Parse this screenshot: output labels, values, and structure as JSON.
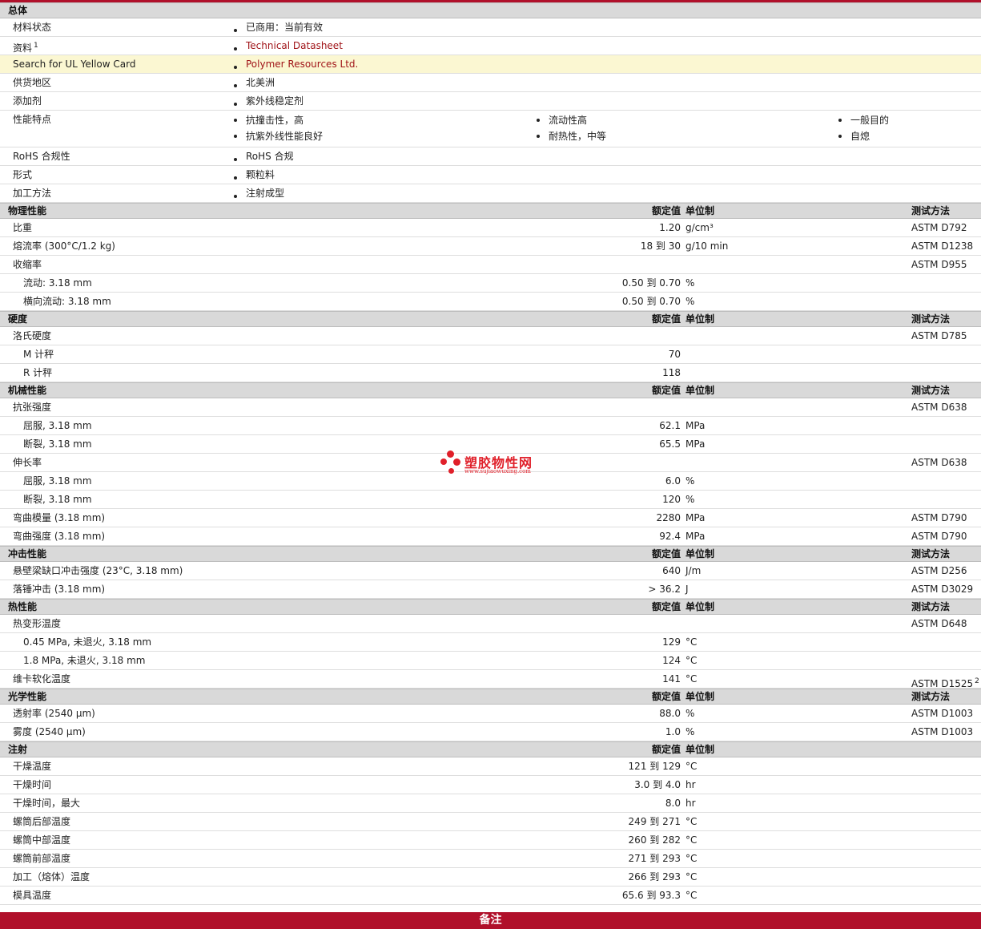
{
  "general": {
    "title": "总体",
    "rows": [
      {
        "label": "材料状态",
        "value": "已商用：当前有效"
      },
      {
        "label": "资料",
        "sup": "1",
        "value": "Technical Datasheet"
      },
      {
        "label": "Search for UL Yellow Card",
        "value": "Polymer Resources Ltd."
      },
      {
        "label": "供货地区",
        "value": "北美洲"
      },
      {
        "label": "添加剂",
        "value": "紫外线稳定剂"
      },
      {
        "label": "性能特点",
        "cols": [
          [
            "抗撞击性，高",
            "抗紫外线性能良好"
          ],
          [
            "流动性高",
            "耐热性，中等"
          ],
          [
            "一般目的",
            "自熄"
          ]
        ]
      },
      {
        "label": "RoHS 合规性",
        "value": "RoHS 合规"
      },
      {
        "label": "形式",
        "value": "颗粒料"
      },
      {
        "label": "加工方法",
        "value": "注射成型"
      }
    ]
  },
  "headers": {
    "value": "额定值",
    "unit": "单位制",
    "method": "测试方法"
  },
  "sections": [
    {
      "title": "物理性能",
      "rows": [
        {
          "label": "比重",
          "value": "1.20",
          "unit": "g/cm³",
          "method": "ASTM D792"
        },
        {
          "label": "熔流率  (300°C/1.2 kg)",
          "value": "18 到  30",
          "unit": "g/10 min",
          "method": "ASTM D1238"
        },
        {
          "label": "收缩率",
          "value": "",
          "unit": "",
          "method": "ASTM D955"
        },
        {
          "label": "流动: 3.18 mm",
          "sub": true,
          "value": "0.50 到  0.70",
          "unit": "%",
          "method": ""
        },
        {
          "label": "横向流动: 3.18 mm",
          "sub": true,
          "value": "0.50 到  0.70",
          "unit": "%",
          "method": ""
        }
      ]
    },
    {
      "title": "硬度",
      "rows": [
        {
          "label": "洛氏硬度",
          "value": "",
          "unit": "",
          "method": "ASTM D785"
        },
        {
          "label": "M 计秤",
          "sub": true,
          "value": "70",
          "unit": "",
          "method": ""
        },
        {
          "label": "R 计秤",
          "sub": true,
          "value": "118",
          "unit": "",
          "method": ""
        }
      ]
    },
    {
      "title": "机械性能",
      "rows": [
        {
          "label": "抗张强度",
          "value": "",
          "unit": "",
          "method": "ASTM D638"
        },
        {
          "label": "屈服, 3.18 mm",
          "sub": true,
          "value": "62.1",
          "unit": "MPa",
          "method": ""
        },
        {
          "label": "断裂, 3.18 mm",
          "sub": true,
          "value": "65.5",
          "unit": "MPa",
          "method": ""
        },
        {
          "label": "伸长率",
          "value": "",
          "unit": "",
          "method": "ASTM D638"
        },
        {
          "label": "屈服, 3.18 mm",
          "sub": true,
          "value": "6.0",
          "unit": "%",
          "method": ""
        },
        {
          "label": "断裂, 3.18 mm",
          "sub": true,
          "value": "120",
          "unit": "%",
          "method": ""
        },
        {
          "label": "弯曲模量  (3.18 mm)",
          "value": "2280",
          "unit": "MPa",
          "method": "ASTM D790"
        },
        {
          "label": "弯曲强度  (3.18 mm)",
          "value": "92.4",
          "unit": "MPa",
          "method": "ASTM D790"
        }
      ]
    },
    {
      "title": "冲击性能",
      "rows": [
        {
          "label": "悬壁梁缺口冲击强度  (23°C, 3.18 mm)",
          "value": "640",
          "unit": "J/m",
          "method": "ASTM D256"
        },
        {
          "label": "落锤冲击  (3.18 mm)",
          "value": "> 36.2",
          "unit": "J",
          "method": "ASTM D3029"
        }
      ]
    },
    {
      "title": "热性能",
      "rows": [
        {
          "label": "热变形温度",
          "value": "",
          "unit": "",
          "method": "ASTM D648"
        },
        {
          "label": "0.45 MPa, 未退火, 3.18 mm",
          "sub": true,
          "value": "129",
          "unit": "°C",
          "method": ""
        },
        {
          "label": "1.8 MPa, 未退火, 3.18 mm",
          "sub": true,
          "value": "124",
          "unit": "°C",
          "method": ""
        },
        {
          "label": "维卡软化温度",
          "value": "141",
          "unit": "°C",
          "method": "ASTM D1525",
          "sup": "2"
        }
      ]
    },
    {
      "title": "光学性能",
      "rows": [
        {
          "label": "透射率  (2540 µm)",
          "value": "88.0",
          "unit": "%",
          "method": "ASTM D1003"
        },
        {
          "label": "雾度  (2540 µm)",
          "value": "1.0",
          "unit": "%",
          "method": "ASTM D1003"
        }
      ]
    },
    {
      "title": "注射",
      "noMethod": true,
      "rows": [
        {
          "label": "干燥温度",
          "value": "121 到  129",
          "unit": "°C",
          "method": ""
        },
        {
          "label": "干燥时间",
          "value": "3.0 到  4.0",
          "unit": "hr",
          "method": ""
        },
        {
          "label": "干燥时间，最大",
          "value": "8.0",
          "unit": "hr",
          "method": ""
        },
        {
          "label": "螺筒后部温度",
          "value": "249 到  271",
          "unit": "°C",
          "method": ""
        },
        {
          "label": "螺筒中部温度",
          "value": "260 到  282",
          "unit": "°C",
          "method": ""
        },
        {
          "label": "螺筒前部温度",
          "value": "271 到  293",
          "unit": "°C",
          "method": ""
        },
        {
          "label": "加工（熔体）温度",
          "value": "266 到  293",
          "unit": "°C",
          "method": ""
        },
        {
          "label": "模具温度",
          "value": "65.6 到  93.3",
          "unit": "°C",
          "method": ""
        }
      ]
    }
  ],
  "footer": "备注",
  "watermark": {
    "title": "塑胶物性网",
    "url": "www.sujiaowuxing.com"
  }
}
